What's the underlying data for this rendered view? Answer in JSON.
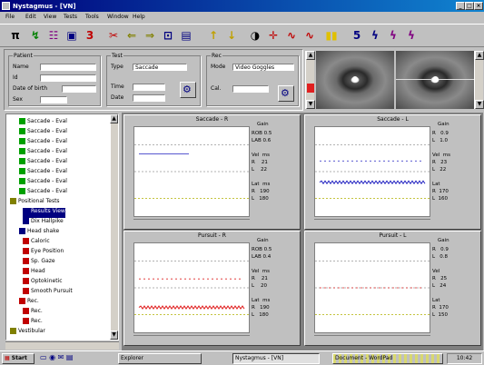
{
  "app": {
    "title": "Nystagmus - [VN]"
  },
  "menu": [
    "File",
    "Edit",
    "View",
    "Tests",
    "Tools",
    "Window",
    "Help"
  ],
  "toolbar_icons": [
    "tree-view-icon",
    "graph-icon",
    "chart-icon",
    "camera-icon",
    "record-icon",
    "scissors-icon",
    "prev-icon",
    "next-icon",
    "save-icon",
    "print-icon",
    "arrow-up-icon",
    "arrow-down-icon",
    "stimulus-icon",
    "target-icon",
    "wave-icon",
    "pause-icon",
    "bars-icon",
    "measure-icon",
    "measure2-icon",
    "measure3-icon",
    "calib-icon"
  ],
  "patient": {
    "group": "Patient",
    "name_label": "Name",
    "id_label": "Id",
    "dob_label": "Date of birth",
    "sex_label": "Sex"
  },
  "test": {
    "group": "Test",
    "type_label": "Type",
    "type_value": "Saccade",
    "time_label": "Time",
    "date_label": "Date"
  },
  "recording": {
    "group": "Rec",
    "mode_label": "Mode",
    "mode_value": "Video Goggles",
    "cal_label": "Cal."
  },
  "tree": {
    "items": [
      "Saccade - Eval",
      "Saccade - Eval",
      "Saccade - Eval",
      "Saccade - Eval",
      "Saccade - Eval",
      "Saccade - Eval",
      "Saccade - Eval",
      "Saccade - Eval",
      "Positional Tests",
      "Results View",
      "Dix Hallpike",
      "Head shake",
      "Caloric",
      "Eye Position",
      "Sp. Gaze",
      "Head",
      "Optokinetic",
      "Smooth Pursuit",
      "Rec.",
      "Rec.",
      "Rec.",
      "Vestibular"
    ]
  },
  "charts": [
    {
      "title": "Saccade - R",
      "info_header": "Gain",
      "info": "ROB 0.5\nLAB 0.6\n\nVel  ms\nR    21\nL    22\n\nLat  ms\nR   190\nL   180"
    },
    {
      "title": "Saccade - L",
      "info_header": "Gain",
      "info": "R   0.9\nL   1.0\n\nVel  ms\nR   23\nL   22\n\nLat\nR  170\nL  160"
    },
    {
      "title": "Pursuit - R",
      "info_header": "Gain",
      "info": "ROB 0.5\nLAB 0.4\n\nVel  ms\nR    21\nL    20\n\nLat  ms\nR   190\nL   180"
    },
    {
      "title": "Pursuit - L",
      "info_header": "Gain",
      "info": "R   0.9\nL   0.8\n\nVel\nR   25\nL   24\n\nLat\nR  170\nL  150"
    }
  ],
  "taskbar": {
    "start": "Start",
    "tasks": [
      "Explorer",
      "Nystagmus - [VN]",
      "Document - WordPad"
    ],
    "clock": "10:42"
  },
  "colors": {
    "title_bar": "#00007b",
    "pos_trace": "#2020c0",
    "neg_trace": "#e02020",
    "grid": "#999999",
    "eye_pupil": "#2a2a2a"
  }
}
